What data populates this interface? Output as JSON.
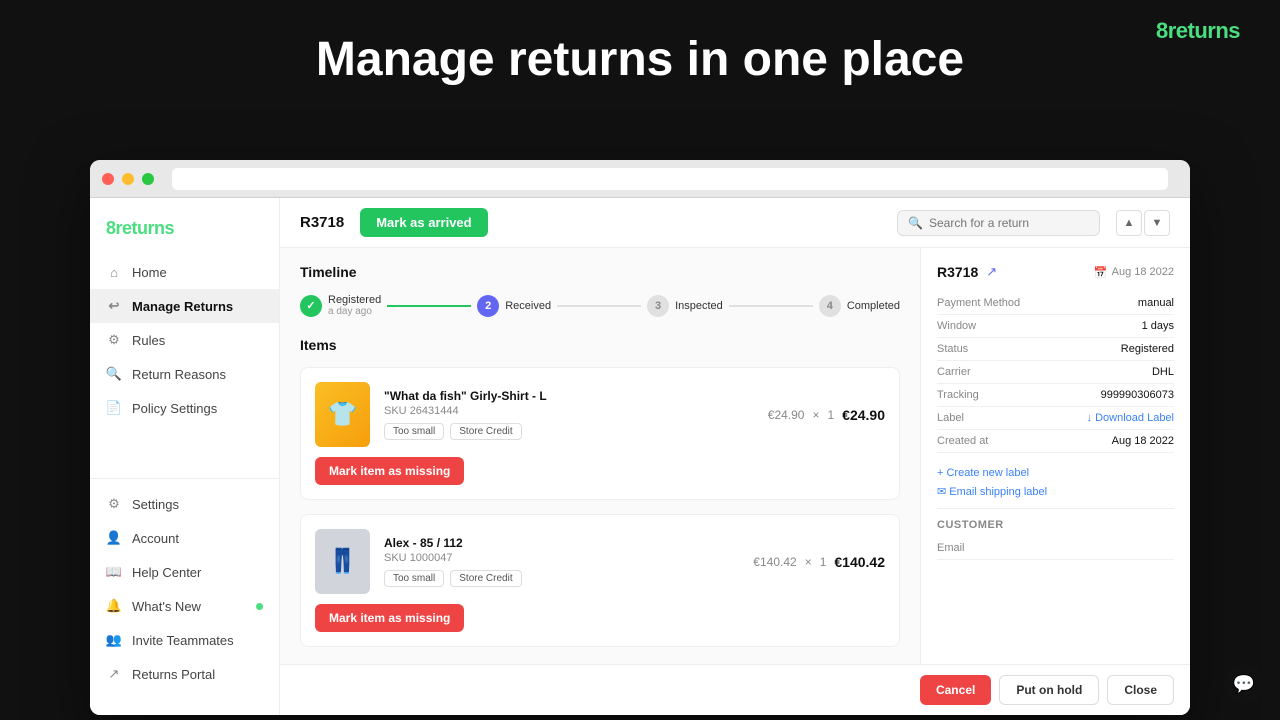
{
  "brand": {
    "name": "8returns",
    "number": "8",
    "rest": "returns"
  },
  "hero": {
    "title": "Manage returns in one place"
  },
  "sidebar": {
    "brand": "8returns",
    "items": [
      {
        "id": "home",
        "label": "Home",
        "icon": "home-icon",
        "active": false
      },
      {
        "id": "manage-returns",
        "label": "Manage Returns",
        "icon": "returns-icon",
        "active": true
      },
      {
        "id": "rules",
        "label": "Rules",
        "icon": "rules-icon",
        "active": false
      },
      {
        "id": "return-reasons",
        "label": "Return Reasons",
        "icon": "reasons-icon",
        "active": false
      },
      {
        "id": "policy-settings",
        "label": "Policy Settings",
        "icon": "policy-icon",
        "active": false
      }
    ],
    "bottom_items": [
      {
        "id": "settings",
        "label": "Settings",
        "icon": "settings-icon"
      },
      {
        "id": "account",
        "label": "Account",
        "icon": "account-icon"
      },
      {
        "id": "help-center",
        "label": "Help Center",
        "icon": "help-icon"
      },
      {
        "id": "whats-new",
        "label": "What's New",
        "icon": "new-icon",
        "has_dot": true
      }
    ],
    "invite": "Invite Teammates",
    "portal": "Returns Portal"
  },
  "header": {
    "return_id": "R3718",
    "mark_arrived_label": "Mark as arrived",
    "search_placeholder": "Search for a return"
  },
  "timeline": {
    "title": "Timeline",
    "steps": [
      {
        "id": "registered",
        "label": "Registered",
        "sublabel": "a day ago",
        "type": "check",
        "num": "✓"
      },
      {
        "id": "received",
        "label": "Received",
        "sublabel": "",
        "type": "num",
        "num": "2"
      },
      {
        "id": "inspected",
        "label": "Inspected",
        "sublabel": "",
        "type": "num_gray",
        "num": "3"
      },
      {
        "id": "completed",
        "label": "Completed",
        "sublabel": "",
        "type": "num_gray",
        "num": "4"
      }
    ]
  },
  "items": {
    "title": "Items",
    "list": [
      {
        "id": "item1",
        "name": "\"What da fish\" Girly-Shirt - L",
        "sku_label": "SKU",
        "sku": "26431444",
        "tags": [
          "Too small",
          "Store Credit"
        ],
        "price": "€24.90",
        "qty": "1",
        "total": "€24.90",
        "btn_missing": "Mark item as missing",
        "emoji": "👕"
      },
      {
        "id": "item2",
        "name": "Alex - 85 / 112",
        "sku_label": "SKU",
        "sku": "1000047",
        "tags": [
          "Too small",
          "Store Credit"
        ],
        "price": "€140.42",
        "qty": "1",
        "total": "€140.42",
        "btn_missing": "Mark item as missing",
        "emoji": "👖"
      }
    ]
  },
  "right_panel": {
    "return_id": "R3718",
    "date_icon": "📅",
    "date": "Aug 18 2022",
    "info_rows": [
      {
        "label": "Payment Method",
        "value": "manual"
      },
      {
        "label": "Window",
        "value": "1 days"
      },
      {
        "label": "Status",
        "value": "Registered"
      },
      {
        "label": "Carrier",
        "value": "DHL"
      },
      {
        "label": "Tracking",
        "value": "999990306073"
      },
      {
        "label": "Label",
        "value": ""
      },
      {
        "label": "Created at",
        "value": "Aug 18 2022"
      }
    ],
    "label_link": "↓ Download Label",
    "create_label": "+ Create new label",
    "email_label": "✉ Email shipping label",
    "customer_section": "Customer",
    "email_label_text": "Email"
  },
  "footer": {
    "cancel_label": "Cancel",
    "hold_label": "Put on hold",
    "close_label": "Close"
  }
}
